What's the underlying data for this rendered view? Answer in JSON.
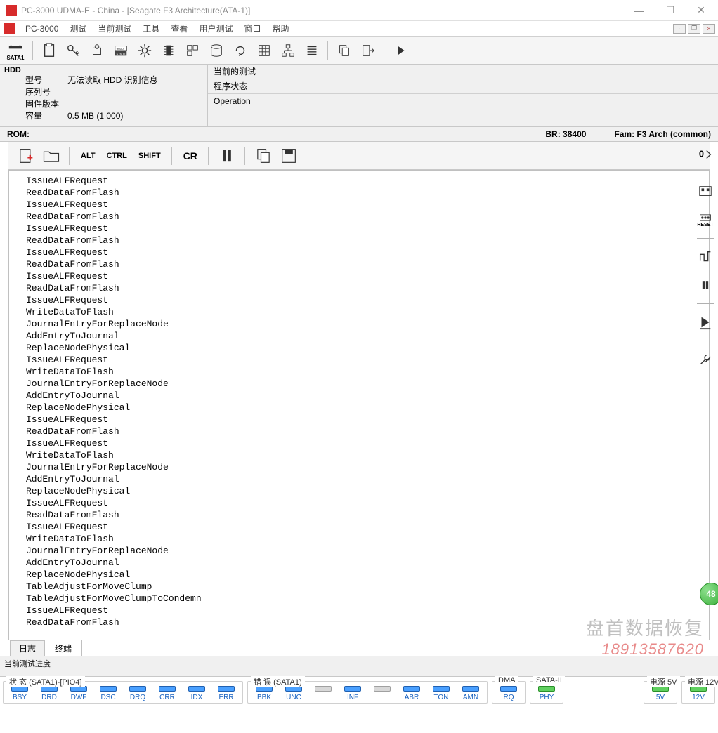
{
  "titlebar": {
    "title": "PC-3000 UDMA-E - China - [Seagate F3 Architecture(ATA-1)]"
  },
  "menubar": {
    "app": "PC-3000",
    "items": [
      "测试",
      "当前测试",
      "工具",
      "查看",
      "用户测试",
      "窗口",
      "帮助"
    ]
  },
  "toolbar": {
    "sata_label": "SATA1"
  },
  "hdd": {
    "heading": "HDD",
    "model_label": "型号",
    "model_value": "无法读取 HDD 识别信息",
    "serial_label": "序列号",
    "serial_value": "",
    "firmware_label": "固件版本",
    "firmware_value": "",
    "capacity_label": "容量",
    "capacity_value": "0.5 MB (1 000)"
  },
  "panels": {
    "current_test_label": "当前的测试",
    "current_test_value": "",
    "program_state_label": "程序状态",
    "operation_label": "Operation"
  },
  "rom_row": {
    "rom": "ROM:",
    "br": "BR: 38400",
    "fam": "Fam: F3 Arch (common)"
  },
  "toolbar2": {
    "alt": "ALT",
    "ctrl": "CTRL",
    "shift": "SHIFT",
    "cr": "CR"
  },
  "right_toolbar": {
    "reset": "RESET"
  },
  "terminal_lines": [
    "IssueALFRequest",
    "ReadDataFromFlash",
    "IssueALFRequest",
    "ReadDataFromFlash",
    "IssueALFRequest",
    "ReadDataFromFlash",
    "IssueALFRequest",
    "ReadDataFromFlash",
    "IssueALFRequest",
    "ReadDataFromFlash",
    "IssueALFRequest",
    "WriteDataToFlash",
    "JournalEntryForReplaceNode",
    "AddEntryToJournal",
    "ReplaceNodePhysical",
    "IssueALFRequest",
    "WriteDataToFlash",
    "JournalEntryForReplaceNode",
    "AddEntryToJournal",
    "ReplaceNodePhysical",
    "IssueALFRequest",
    "ReadDataFromFlash",
    "IssueALFRequest",
    "WriteDataToFlash",
    "JournalEntryForReplaceNode",
    "AddEntryToJournal",
    "ReplaceNodePhysical",
    "IssueALFRequest",
    "ReadDataFromFlash",
    "IssueALFRequest",
    "WriteDataToFlash",
    "JournalEntryForReplaceNode",
    "AddEntryToJournal",
    "ReplaceNodePhysical",
    "TableAdjustForMoveClump",
    "TableAdjustForMoveClumpToCondemn",
    "IssueALFRequest",
    "ReadDataFromFlash"
  ],
  "tabs": {
    "log": "日志",
    "terminal": "终端"
  },
  "progress": {
    "label": "当前测试进度"
  },
  "status": {
    "state_group": "状 态 (SATA1)-[PIO4]",
    "state_leds": [
      "BSY",
      "DRD",
      "DWF",
      "DSC",
      "DRQ",
      "CRR",
      "IDX",
      "ERR"
    ],
    "error_group": "错 误 (SATA1)",
    "error_leds": [
      "BBK",
      "UNC",
      "",
      "INF",
      "",
      "ABR",
      "TON",
      "AMN"
    ],
    "dma_group": "DMA",
    "dma_leds": [
      "RQ"
    ],
    "sata2_group": "SATA-II",
    "sata2_leds": [
      "PHY"
    ],
    "power5_group": "电源 5V",
    "power5_leds": [
      "5V"
    ],
    "power12_group": "电源 12V",
    "power12_leds": [
      "12V"
    ]
  },
  "watermark": {
    "line1": "盘首数据恢复",
    "line2": "18913587620"
  },
  "badge": "48"
}
